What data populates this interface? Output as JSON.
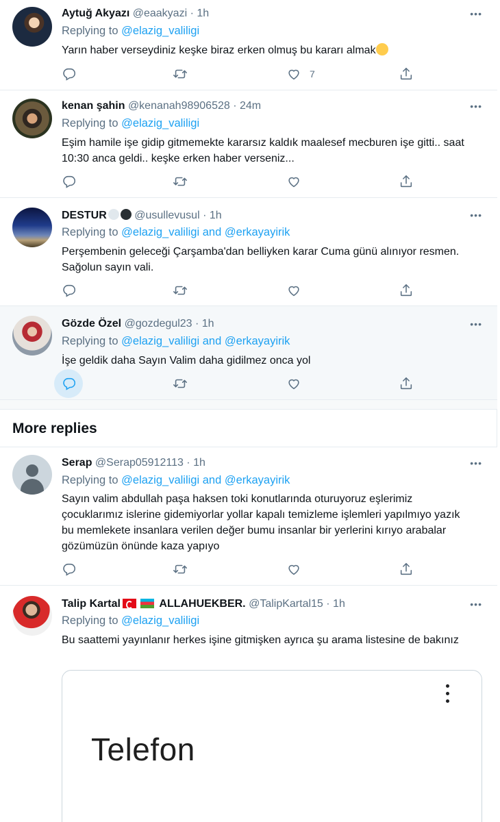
{
  "tweets": [
    {
      "name": "Aytuğ Akyazı",
      "handle": "@eaakyazi · 1h",
      "replying_prefix": "Replying to",
      "mentions": "@elazig_valiligi",
      "text": "Yarın haber verseydiniz keşke biraz erken olmuş bu kararı almak",
      "like_count": "7"
    },
    {
      "name": "kenan şahin",
      "handle": "@kenanah98906528 · 24m",
      "replying_prefix": "Replying to",
      "mentions": "@elazig_valiligi",
      "text": "Eşim hamile  işe gidip gitmemekte kararsız kaldık maalesef mecburen işe gitti.. saat 10:30 anca geldi.. keşke erken haber verseniz..."
    },
    {
      "name": "DESTUR",
      "handle": "@usullevusul · 1h",
      "replying_prefix": "Replying to",
      "mentions": "@elazig_valiligi and @erkayayirik",
      "text": "Perşembenin geleceği Çarşamba'dan belliyken karar Cuma günü alınıyor resmen. Sağolun sayın vali."
    },
    {
      "name": "Gözde Özel",
      "handle": "@gozdegul23 · 1h",
      "replying_prefix": "Replying to",
      "mentions": "@elazig_valiligi and @erkayayirik",
      "text": "İşe geldik daha Sayın Valim daha gidilmez onca yol"
    }
  ],
  "more_replies_title": "More replies",
  "more_replies": [
    {
      "name": "Serap",
      "handle": "@Serap05912113 · 1h",
      "replying_prefix": "Replying to",
      "mentions": "@elazig_valiligi and @erkayayirik",
      "text": "Sayın valim abdullah paşa haksen toki konutlarında oturuyoruz eşlerimiz çocuklarımız islerine gidemiyorlar yollar kapalı temizleme işlemleri yapılmıyo yazık bu memlekete insanlara verilen değer bumu insanlar bir yerlerini kırıyo arabalar gözümüzün önünde kaza yapıyo"
    },
    {
      "name": "Talip Kartal",
      "name_suffix": "ALLAHUEKBER.",
      "handle": "@TalipKartal15 · 1h",
      "replying_prefix": "Replying to",
      "mentions": "@elazig_valiligi",
      "text": "Bu saattemi yayınlanır herkes işine gitmişken ayrıca şu arama listesine de bakınız",
      "card_title": "Telefon"
    }
  ],
  "colors": {
    "accent": "#1da1f2",
    "secondary_text": "#5b7083",
    "highlight_bg": "#f5f8fa"
  },
  "icons": [
    "reply-icon",
    "retweet-icon",
    "like-icon",
    "share-icon",
    "more-icon"
  ]
}
